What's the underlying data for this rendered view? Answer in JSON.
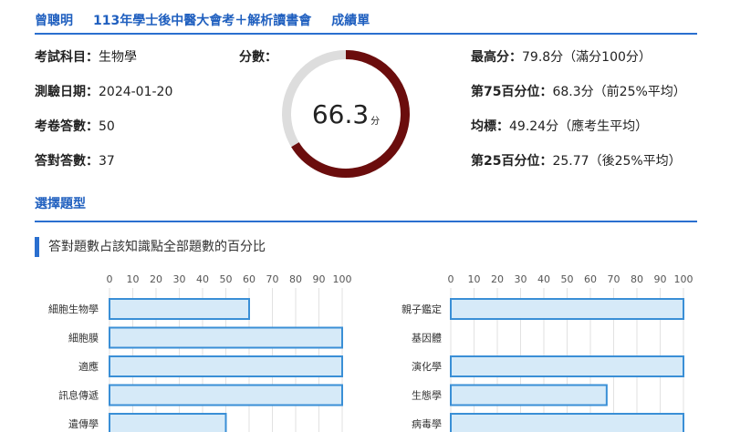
{
  "header": {
    "name": "曾聰明",
    "exam": "113年學士後中醫大會考＋解析讀書會",
    "report": "成績單"
  },
  "info_left": [
    {
      "key": "考試科目：",
      "value": "生物學"
    },
    {
      "key": "測驗日期：",
      "value": "2024-01-20"
    },
    {
      "key": "考卷答數：",
      "value": "50"
    },
    {
      "key": "答對答數：",
      "value": "37"
    }
  ],
  "score": {
    "label": "分數：",
    "value": "66.3",
    "unit": "分",
    "fraction": 0.663,
    "color_fill": "#6b0d0d",
    "color_track": "#dddddd"
  },
  "info_right": [
    {
      "key": "最高分：",
      "value": "79.8分（滿分100分）"
    },
    {
      "key": "第75百分位：",
      "value": "68.3分（前25%平均）"
    },
    {
      "key": "均標：",
      "value": "49.24分（應考生平均）"
    },
    {
      "key": "第25百分位：",
      "value": "25.77（後25%平均）"
    }
  ],
  "section_title": "選擇題型",
  "chart_subtitle": "答對題數占該知識點全部題數的百分比",
  "colors": {
    "accent": "#2a6fcf",
    "bar_fill": "#d6eaf8",
    "bar_stroke": "#3a8fd6"
  },
  "chart_data": [
    {
      "type": "bar",
      "orientation": "horizontal",
      "categories": [
        "細胞生物學",
        "細胞膜",
        "適應",
        "訊息傳遞",
        "遺傳學"
      ],
      "values": [
        60,
        100,
        100,
        100,
        50
      ],
      "xlim": [
        0,
        100
      ],
      "xticks": [
        "0",
        "10",
        "20",
        "30",
        "40",
        "50",
        "60",
        "70",
        "80",
        "90",
        "100"
      ],
      "grid": true
    },
    {
      "type": "bar",
      "orientation": "horizontal",
      "categories": [
        "親子鑑定",
        "基因體",
        "演化學",
        "生態學",
        "病毒學"
      ],
      "values": [
        100,
        0,
        100,
        67,
        100
      ],
      "xlim": [
        0,
        100
      ],
      "xticks": [
        "0",
        "10",
        "20",
        "30",
        "40",
        "50",
        "60",
        "70",
        "80",
        "90",
        "100"
      ],
      "grid": true
    }
  ]
}
